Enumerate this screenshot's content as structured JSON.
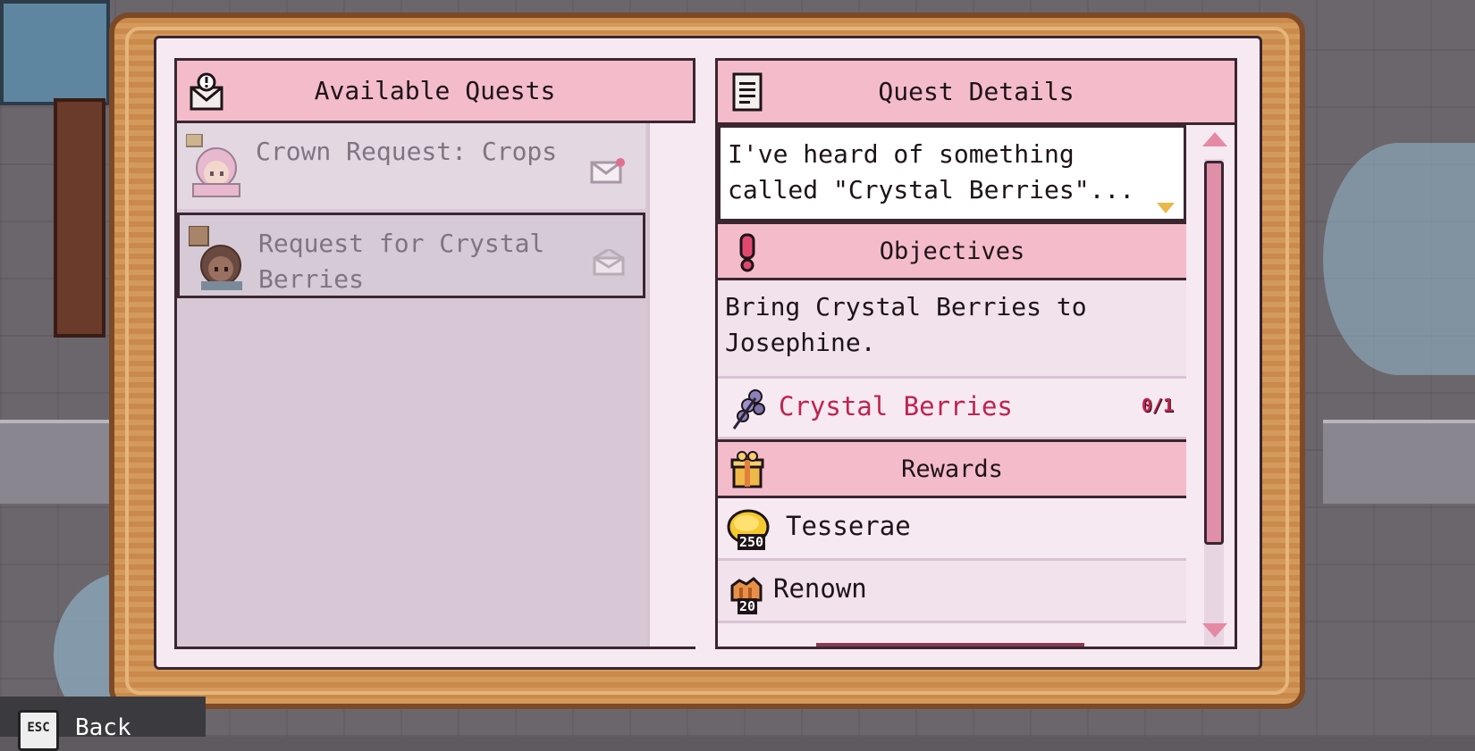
{
  "left_panel": {
    "title": "Available Quests",
    "icon": "quest-envelope-icon",
    "quests": [
      {
        "title": "Crown Request: Crops",
        "portrait": "pink-hair-girl-crown-portrait",
        "mail_icon": "new-mail-icon",
        "selected": false
      },
      {
        "title": "Request for Crystal Berries",
        "portrait": "josephine-portrait",
        "mail_icon": "opened-mail-icon",
        "selected": true
      }
    ]
  },
  "right_panel": {
    "title": "Quest Details",
    "icon": "document-icon",
    "description": "I've heard of something\ncalled \"Crystal Berries\"...",
    "objectives": {
      "title": "Objectives",
      "icon": "exclamation-icon",
      "text": "Bring Crystal Berries to\nJosephine.",
      "item": {
        "name": "Crystal Berries",
        "icon": "crystal-berries-icon",
        "count": "0/1"
      }
    },
    "rewards": {
      "title": "Rewards",
      "icon": "gift-icon",
      "items": [
        {
          "name": "Tesserae",
          "icon": "tesserae-coin-icon",
          "qty": "250"
        },
        {
          "name": "Renown",
          "icon": "renown-icon",
          "qty": "20"
        }
      ]
    }
  },
  "footer": {
    "key": "ESC",
    "label": "Back"
  },
  "colors": {
    "header_pink": "#f4bccb",
    "paper": "#f7e9f2",
    "accent_red": "#c0224e",
    "frame_wood": "#d49a5c"
  }
}
